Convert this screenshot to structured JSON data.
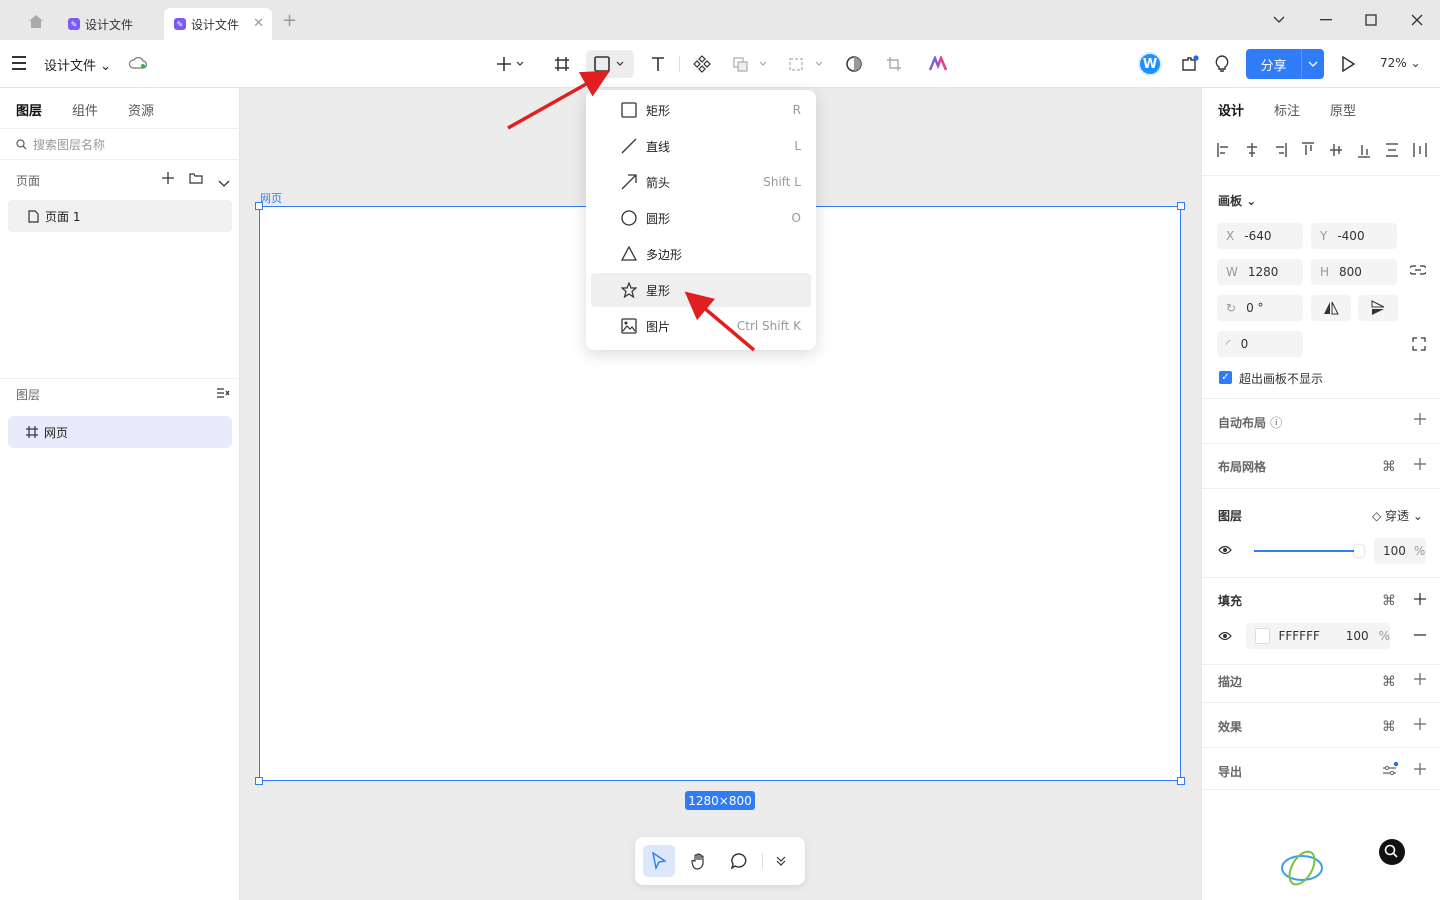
{
  "tabs": [
    {
      "label": "设计文件"
    },
    {
      "label": "设计文件"
    }
  ],
  "header": {
    "file_title": "设计文件",
    "share_label": "分享",
    "zoom": "72%",
    "avatar_letter": "W"
  },
  "left": {
    "tabs": [
      "图层",
      "组件",
      "资源"
    ],
    "search_placeholder": "搜索图层名称",
    "pages_title": "页面",
    "page_item": "页面 1",
    "layers_title": "图层",
    "layer_item": "网页"
  },
  "canvas": {
    "frame_label": "网页",
    "size_badge": "1280×800"
  },
  "dropdown": {
    "items": [
      {
        "label": "矩形",
        "shortcut": "R"
      },
      {
        "label": "直线",
        "shortcut": "L"
      },
      {
        "label": "箭头",
        "shortcut": "Shift L"
      },
      {
        "label": "圆形",
        "shortcut": "O"
      },
      {
        "label": "多边形",
        "shortcut": ""
      },
      {
        "label": "星形",
        "shortcut": ""
      },
      {
        "label": "图片",
        "shortcut": "Ctrl Shift K"
      }
    ]
  },
  "right": {
    "tabs": [
      "设计",
      "标注",
      "原型"
    ],
    "board_title": "画板",
    "x_key": "X",
    "x_val": "-640",
    "y_key": "Y",
    "y_val": "-400",
    "w_key": "W",
    "w_val": "1280",
    "h_key": "H",
    "h_val": "800",
    "rotation": "0 °",
    "radius": "0",
    "clip_label": "超出画板不显示",
    "auto_layout": "自动布局",
    "layout_grid": "布局网格",
    "layer_title": "图层",
    "blend_mode": "穿透",
    "opacity": "100",
    "percent": "%",
    "fill_title": "填充",
    "fill_hex": "FFFFFF",
    "fill_opacity": "100",
    "stroke": "描边",
    "effects": "效果",
    "export": "导出"
  },
  "colors": {
    "accent": "#2f7cf6",
    "arrow": "#e02020",
    "tab_icon": "#7b5cf0"
  }
}
